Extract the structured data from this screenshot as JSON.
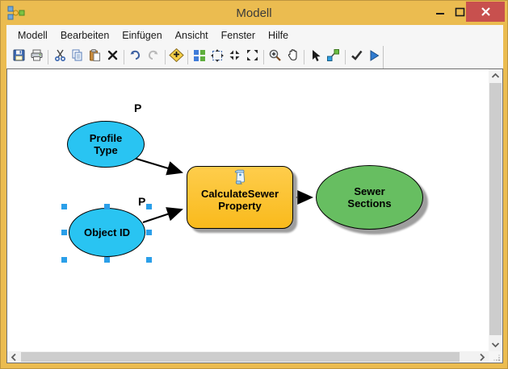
{
  "window": {
    "title": "Modell",
    "titlebar_color": "#EBBC50",
    "close_button_color": "#C8504E"
  },
  "menubar": {
    "items": [
      {
        "label": "Modell"
      },
      {
        "label": "Bearbeiten"
      },
      {
        "label": "Einfügen"
      },
      {
        "label": "Ansicht"
      },
      {
        "label": "Fenster"
      },
      {
        "label": "Hilfe"
      }
    ]
  },
  "toolbar": {
    "icons": [
      "save",
      "print",
      "cut",
      "copy",
      "paste",
      "delete",
      "undo",
      "redo",
      "add-data",
      "auto-layout",
      "full-extent",
      "fixed-zoom-in",
      "fixed-zoom-out",
      "zoom-in",
      "pan",
      "select",
      "connect",
      "validate",
      "run"
    ]
  },
  "model": {
    "nodes": [
      {
        "id": "profile-type",
        "type": "input-variable",
        "shape": "ellipse",
        "fill": "#29C4F2",
        "label_lines": [
          "Profile",
          "Type"
        ],
        "parameter_label": "P"
      },
      {
        "id": "object-id",
        "type": "input-variable",
        "shape": "ellipse",
        "fill": "#29C4F2",
        "label_lines": [
          "Object ID"
        ],
        "parameter_label": "P",
        "selected": true
      },
      {
        "id": "calculate-sewer-property",
        "type": "tool",
        "shape": "rounded-rect",
        "fill": "#FBC02D",
        "label_lines": [
          "CalculateSewer",
          "Property"
        ],
        "icon": "script-tool-icon"
      },
      {
        "id": "sewer-sections",
        "type": "output-variable",
        "shape": "ellipse",
        "fill": "#67BE61",
        "label_lines": [
          "Sewer",
          "Sections"
        ]
      }
    ],
    "connections": [
      {
        "from": "profile-type",
        "to": "calculate-sewer-property"
      },
      {
        "from": "object-id",
        "to": "calculate-sewer-property"
      },
      {
        "from": "calculate-sewer-property",
        "to": "sewer-sections"
      }
    ]
  }
}
